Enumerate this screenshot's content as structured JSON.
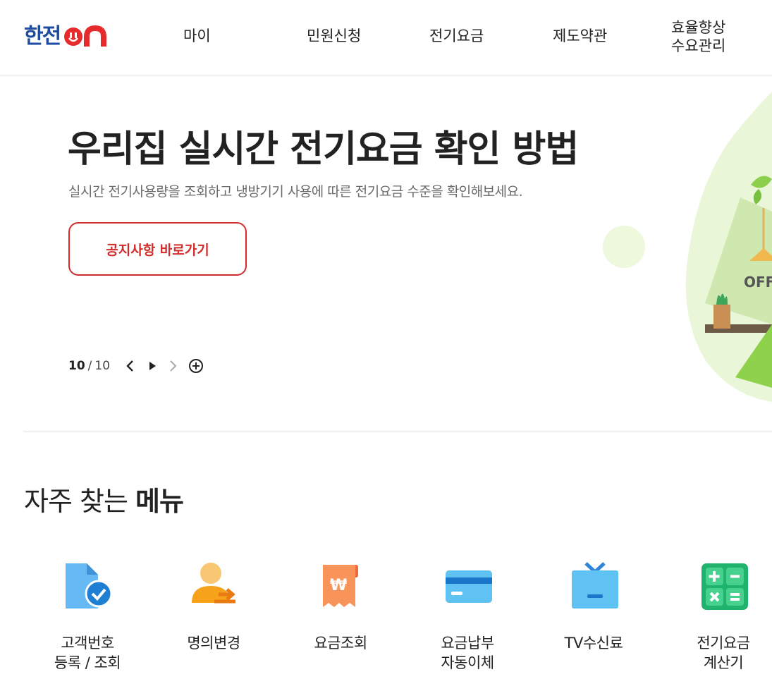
{
  "header": {
    "logo_text": "한전",
    "logo_on": "on",
    "nav": [
      {
        "label": "마이"
      },
      {
        "label": "민원신청"
      },
      {
        "label": "전기요금"
      },
      {
        "label": "제도약관"
      },
      {
        "label": "효율향상\n수요관리"
      }
    ]
  },
  "hero": {
    "title": "우리집 실시간 전기요금 확인 방법",
    "subtitle": "실시간 전기사용량을 조회하고 냉방기기 사용에 따른 전기요금 수준을 확인해보세요.",
    "button_label": "공지사항 바로가기",
    "pager": {
      "current": "10",
      "separator": "/",
      "total": "10"
    },
    "art_text": "OFF"
  },
  "quick_menu": {
    "title_normal": "자주 찾는 ",
    "title_bold": "메뉴",
    "items": [
      {
        "label": "고객번호\n등록 / 조회",
        "icon": "customer-document-check-icon"
      },
      {
        "label": "명의변경",
        "icon": "user-transfer-icon"
      },
      {
        "label": "요금조회",
        "icon": "won-receipt-icon"
      },
      {
        "label": "요금납부\n자동이체",
        "icon": "credit-card-icon"
      },
      {
        "label": "TV수신료",
        "icon": "tv-icon"
      },
      {
        "label": "전기요금\n계산기",
        "icon": "calculator-icon"
      }
    ]
  },
  "colors": {
    "brand_blue": "#1e4ca1",
    "accent_red": "#d22b2b",
    "green_art": "#8ed14b"
  }
}
